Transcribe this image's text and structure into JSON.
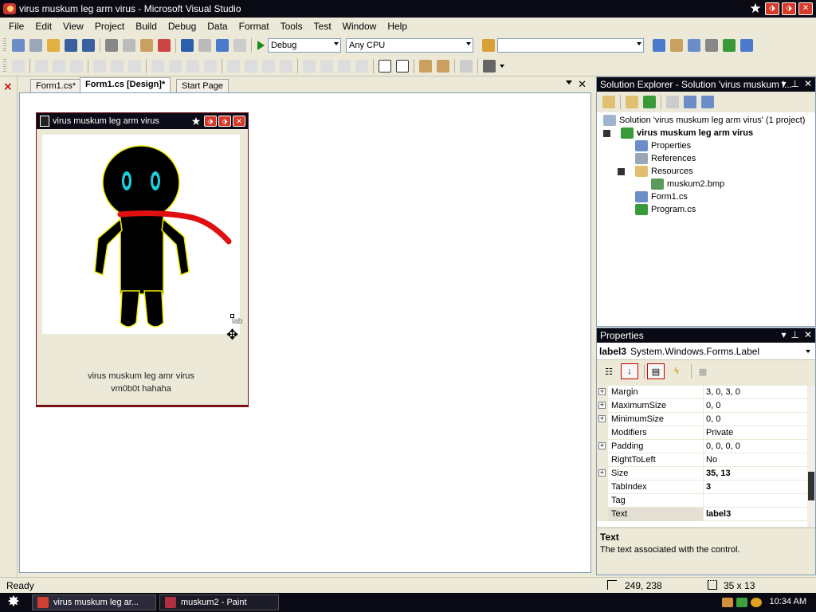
{
  "window": {
    "title": "virus muskum leg arm virus - Microsoft Visual Studio"
  },
  "menubar": {
    "items": [
      "File",
      "Edit",
      "View",
      "Project",
      "Build",
      "Debug",
      "Data",
      "Format",
      "Tools",
      "Test",
      "Window",
      "Help"
    ]
  },
  "toolbar": {
    "configuration": "Debug",
    "platform": "Any CPU"
  },
  "tabs": [
    {
      "label": "Form1.cs*"
    },
    {
      "label": "Form1.cs [Design]*"
    },
    {
      "label": "Start Page"
    }
  ],
  "form": {
    "title": "virus muskum leg arm virus",
    "label_line1": "virus muskum leg amr virus",
    "label_line2": "vm0b0t hahaha",
    "selected_label_text": "lab"
  },
  "solution_explorer": {
    "header": "Solution Explorer - Solution 'virus muskum l...",
    "solution": "Solution 'virus muskum leg arm virus' (1 project)",
    "project": "virus muskum leg arm virus",
    "items": [
      {
        "label": "Properties"
      },
      {
        "label": "References"
      },
      {
        "label": "Resources"
      },
      {
        "label": "muskum2.bmp"
      },
      {
        "label": "Form1.cs"
      },
      {
        "label": "Program.cs"
      }
    ]
  },
  "properties": {
    "header": "Properties",
    "object_name": "label3",
    "object_type": "System.Windows.Forms.Label",
    "rows": [
      {
        "name": "Margin",
        "value": "3, 0, 3, 0"
      },
      {
        "name": "MaximumSize",
        "value": "0, 0"
      },
      {
        "name": "MinimumSize",
        "value": "0, 0"
      },
      {
        "name": "Modifiers",
        "value": "Private"
      },
      {
        "name": "Padding",
        "value": "0, 0, 0, 0"
      },
      {
        "name": "RightToLeft",
        "value": "No"
      },
      {
        "name": "Size",
        "value": "35, 13"
      },
      {
        "name": "TabIndex",
        "value": "3"
      },
      {
        "name": "Tag",
        "value": ""
      },
      {
        "name": "Text",
        "value": "label3"
      }
    ],
    "description_title": "Text",
    "description_text": "The text associated with the control."
  },
  "statusbar": {
    "status": "Ready",
    "position": "249, 238",
    "size": "35 x 13"
  },
  "taskbar": {
    "tasks": [
      {
        "label": "virus muskum leg ar..."
      },
      {
        "label": "muskum2 - Paint"
      }
    ],
    "clock": "10:34 AM"
  }
}
